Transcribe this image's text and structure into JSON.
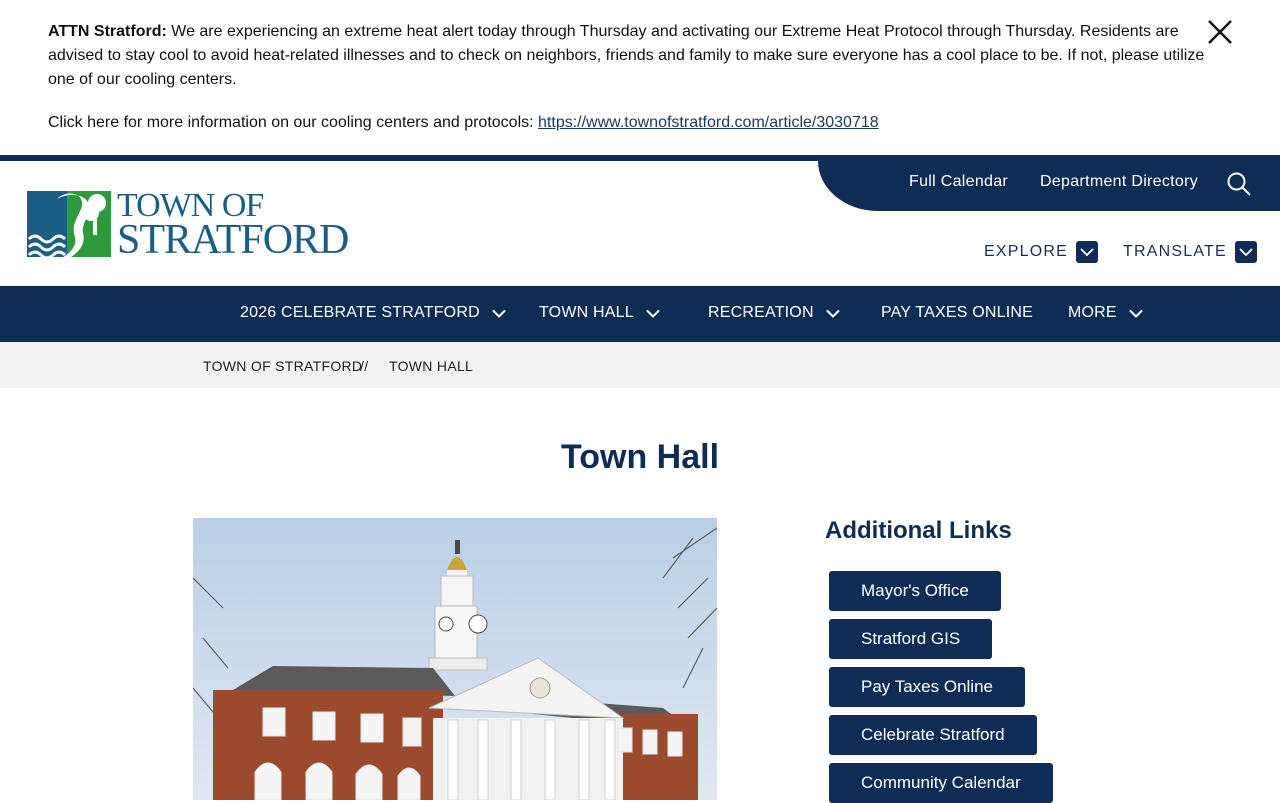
{
  "alert": {
    "label": "ATTN Stratford:",
    "message": "We are experiencing an extreme heat alert today through Thursday and activating our Extreme Heat Protocol through Thursday. Residents are advised to stay cool to avoid heat-related illnesses and to check on neighbors, friends and family to make sure everyone has a cool place to be. If not, please utilize one of our cooling centers.",
    "link_prefix": "Click here for more information on our cooling centers and protocols:",
    "link_text": "https://www.townofstratford.com/article/3030718",
    "close_icon": "close-icon"
  },
  "logo": {
    "line1": "TOWN OF",
    "line2": "STRATFORD"
  },
  "utility": {
    "full_calendar": "Full Calendar",
    "department_directory": "Department Directory",
    "search_icon": "search-icon"
  },
  "header_menus": {
    "explore": "EXPLORE",
    "translate": "TRANSLATE"
  },
  "nav": {
    "items": [
      {
        "label": "2026 CELEBRATE STRATFORD",
        "has_dropdown": true
      },
      {
        "label": "TOWN HALL",
        "has_dropdown": true
      },
      {
        "label": "RECREATION",
        "has_dropdown": true
      },
      {
        "label": "PAY TAXES ONLINE",
        "has_dropdown": false
      },
      {
        "label": "MORE",
        "has_dropdown": true
      }
    ]
  },
  "breadcrumb": {
    "items": [
      "TOWN OF STRATFORD",
      "TOWN HALL"
    ],
    "separator": "//"
  },
  "page": {
    "title": "Town Hall"
  },
  "sidebar": {
    "heading": "Additional Links",
    "links": [
      "Mayor's Office",
      "Stratford GIS",
      "Pay Taxes Online",
      "Celebrate Stratford",
      "Community Calendar"
    ]
  },
  "colors": {
    "navy": "#0f2c55",
    "logo_blue": "#1a5e86",
    "logo_green": "#2e9a3e",
    "breadcrumb_bg": "#f2f2f2"
  }
}
